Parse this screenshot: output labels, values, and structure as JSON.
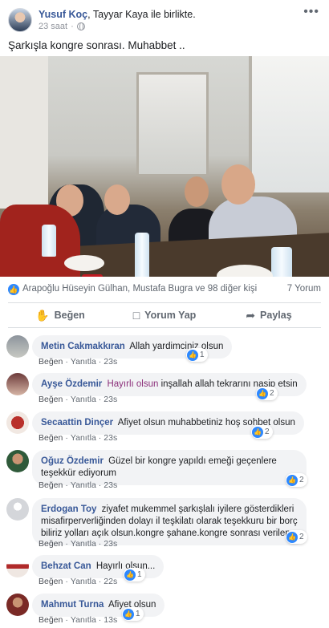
{
  "post": {
    "author": "Yusuf Koç",
    "with_text": ", Tayyar Kaya ile birlikte.",
    "time": "23 saat",
    "more_icon": "more-dots-icon",
    "text": "Şarkışla kongre sonrası. Muhabbet .."
  },
  "reactions": {
    "summary": "Arapoğlu Hüseyin Gülhan, Mustafa Bugra ve 98 diğer kişi",
    "comments_count": "7 Yorum"
  },
  "actions": {
    "like": "Beğen",
    "comment": "Yorum Yap",
    "share": "Paylaş"
  },
  "comment_links": {
    "like": "Beğen",
    "reply": "Yanıtla"
  },
  "comments": [
    {
      "name": "Metin Cakmakkıran",
      "text": "Allah yardimciniz olsun",
      "time": "23s",
      "likes": "1"
    },
    {
      "name": "Ayşe Özdemir",
      "mention": "Hayırlı olsun",
      "text": "inşallah allah tekrarını nasip etsin",
      "time": "23s",
      "likes": "2"
    },
    {
      "name": "Secaattin Dinçer",
      "text": "Afiyet olsun muhabbetiniz hoş sohbet olsun",
      "time": "23s",
      "likes": "2"
    },
    {
      "name": "Oğuz Özdemir",
      "text": "Güzel bir kongre yapıldı emeği geçenlere teşekkür ediyorum",
      "time": "23s",
      "likes": "2"
    },
    {
      "name": "Erdogan Toy",
      "text": "ziyafet mukemmel şarkışlalı iyilere gösterdikleri misafirperverliğinden dolayı il teşkilatı olarak teşekkuru bir borç biliriz yolları açık olsun.kongre şahane.kongre sonrası verilen",
      "time": "23s",
      "likes": "2"
    },
    {
      "name": "Behzat Can",
      "text": "Hayırlı olsun...",
      "time": "22s",
      "likes": "1"
    },
    {
      "name": "Mahmut Turna",
      "text": "Afiyet olsun",
      "time": "13s",
      "likes": "1"
    }
  ],
  "colors": {
    "link": "#385898",
    "like_blue": "#2d88ff",
    "bubble_bg": "#f2f3f5",
    "meta_gray": "#90949c"
  }
}
